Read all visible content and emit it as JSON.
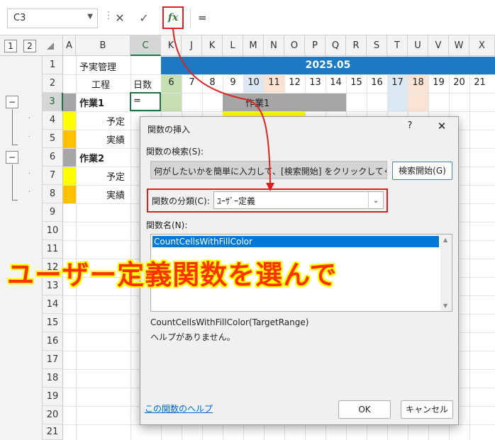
{
  "formula_bar": {
    "name_box": "C3",
    "formula": "=",
    "cancel_glyph": "✕",
    "enter_glyph": "✓",
    "fx_label": "fx"
  },
  "outline": {
    "level1": "1",
    "level2": "2"
  },
  "columns": [
    "A",
    "B",
    "C",
    "K",
    "J",
    "K",
    "L",
    "M",
    "N",
    "O",
    "P",
    "Q",
    "R",
    "S",
    "T",
    "U",
    "V",
    "W",
    "X"
  ],
  "row_numbers": [
    "1",
    "2",
    "3",
    "4",
    "5",
    "6",
    "7",
    "8",
    "9",
    "10",
    "11",
    "12",
    "13",
    "14",
    "15",
    "16",
    "17",
    "18",
    "19",
    "20",
    "21"
  ],
  "day_numbers": [
    "6",
    "7",
    "8",
    "9",
    "10",
    "11",
    "12",
    "13",
    "14",
    "15",
    "16",
    "17",
    "18",
    "19",
    "20",
    "21"
  ],
  "sheet": {
    "b1": "予実管理",
    "month": "2025.05",
    "b2": "工程",
    "c2": "日数",
    "b3": "作業1",
    "c3": "=",
    "task1_bar": "作業1",
    "c4": "予定",
    "c5": "実績",
    "b6": "作業2",
    "c7": "予定",
    "c8": "実績"
  },
  "dialog": {
    "title": "関数の挿入",
    "help_glyph": "?",
    "close_glyph": "✕",
    "search_label": "関数の検索(S):",
    "search_placeholder": "何がしたいかを簡単に入力して、[検索開始] をクリックしてください。",
    "search_button": "検索開始(G)",
    "category_label": "関数の分類(C):",
    "category_value": "ﾕｰｻﾞｰ定義",
    "function_name_label": "関数名(N):",
    "functions": [
      "CountCellsWithFillColor"
    ],
    "signature": "CountCellsWithFillColor(TargetRange)",
    "description": "ヘルプがありません。",
    "help_link": "この関数のヘルプ",
    "ok": "OK",
    "cancel": "キャンセル"
  },
  "callout": "ユーザー定義関数を選んで",
  "colors": {
    "accent_red": "#e02020",
    "header_blue": "#1b7ac2",
    "plan_yellow": "#ffff00",
    "actual_orange": "#ffc000",
    "task_gray": "#a6a6a6"
  }
}
